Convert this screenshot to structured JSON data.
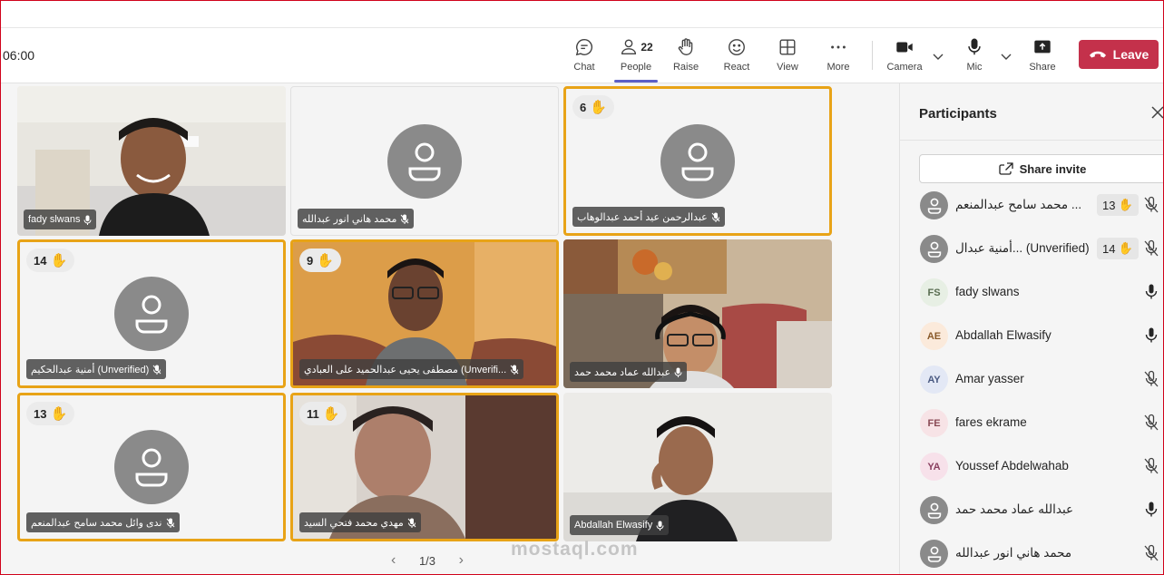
{
  "toolbar": {
    "timer": "06:00",
    "chat_label": "Chat",
    "people_label": "People",
    "people_count": "22",
    "raise_label": "Raise",
    "react_label": "React",
    "view_label": "View",
    "more_label": "More",
    "camera_label": "Camera",
    "mic_label": "Mic",
    "share_label": "Share",
    "leave_label": "Leave"
  },
  "tiles": [
    {
      "name": "fady slwans",
      "hand": "",
      "video": true
    },
    {
      "name": "محمد هاني انور عبدالله",
      "hand": "",
      "video": false
    },
    {
      "name": "عبدالرحمن عيد أحمد عبدالوهاب",
      "hand": "6",
      "video": false
    },
    {
      "name": "أمنية عبدالحكيم (Unverified)",
      "hand": "14",
      "video": false
    },
    {
      "name": "مصطفى يحيى عبدالحميد على العبادي (Unverifi...",
      "hand": "9",
      "video": true
    },
    {
      "name": "عبدالله عماد محمد حمد",
      "hand": "",
      "video": true
    },
    {
      "name": "ندى وائل محمد سامح عبدالمنعم",
      "hand": "13",
      "video": false
    },
    {
      "name": "مهدي محمد فتحي السيد",
      "hand": "11",
      "video": true
    },
    {
      "name": "Abdallah Elwasify",
      "hand": "",
      "video": true
    }
  ],
  "pager": {
    "text": "1/3"
  },
  "watermark": "mostaql.com",
  "panel": {
    "title": "Participants",
    "share_invite": "Share invite",
    "participants": [
      {
        "initials": "",
        "name": "محمد سامح عبدالمنعم ...",
        "hand": "13",
        "muted": true,
        "avatar_bg": "#8a8a8a",
        "avatar_fg": "#fff"
      },
      {
        "initials": "",
        "name": "أمنية عبدال... (Unverified)",
        "hand": "14",
        "muted": true,
        "avatar_bg": "#8a8a8a",
        "avatar_fg": "#fff"
      },
      {
        "initials": "FS",
        "name": "fady slwans",
        "hand": "",
        "muted": false,
        "avatar_bg": "#e7efe4",
        "avatar_fg": "#5a6e52"
      },
      {
        "initials": "AE",
        "name": "Abdallah Elwasify",
        "hand": "",
        "muted": false,
        "avatar_bg": "#fbeadb",
        "avatar_fg": "#8a5a2a"
      },
      {
        "initials": "AY",
        "name": "Amar yasser",
        "hand": "",
        "muted": true,
        "avatar_bg": "#e3e8f5",
        "avatar_fg": "#4a5a82"
      },
      {
        "initials": "FE",
        "name": "fares ekrame",
        "hand": "",
        "muted": true,
        "avatar_bg": "#f7e3e6",
        "avatar_fg": "#8a4a55"
      },
      {
        "initials": "YA",
        "name": "Youssef Abdelwahab",
        "hand": "",
        "muted": true,
        "avatar_bg": "#f7e1ea",
        "avatar_fg": "#8a4060"
      },
      {
        "initials": "",
        "name": "عبدالله عماد محمد حمد",
        "hand": "",
        "muted": false,
        "avatar_bg": "#8a8a8a",
        "avatar_fg": "#fff"
      },
      {
        "initials": "",
        "name": "محمد هاني انور عبدالله",
        "hand": "",
        "muted": true,
        "avatar_bg": "#8a8a8a",
        "avatar_fg": "#fff"
      }
    ]
  },
  "colors": {
    "leave": "#c4314b",
    "highlight": "#e8a317",
    "accent": "#5b5fc7"
  }
}
